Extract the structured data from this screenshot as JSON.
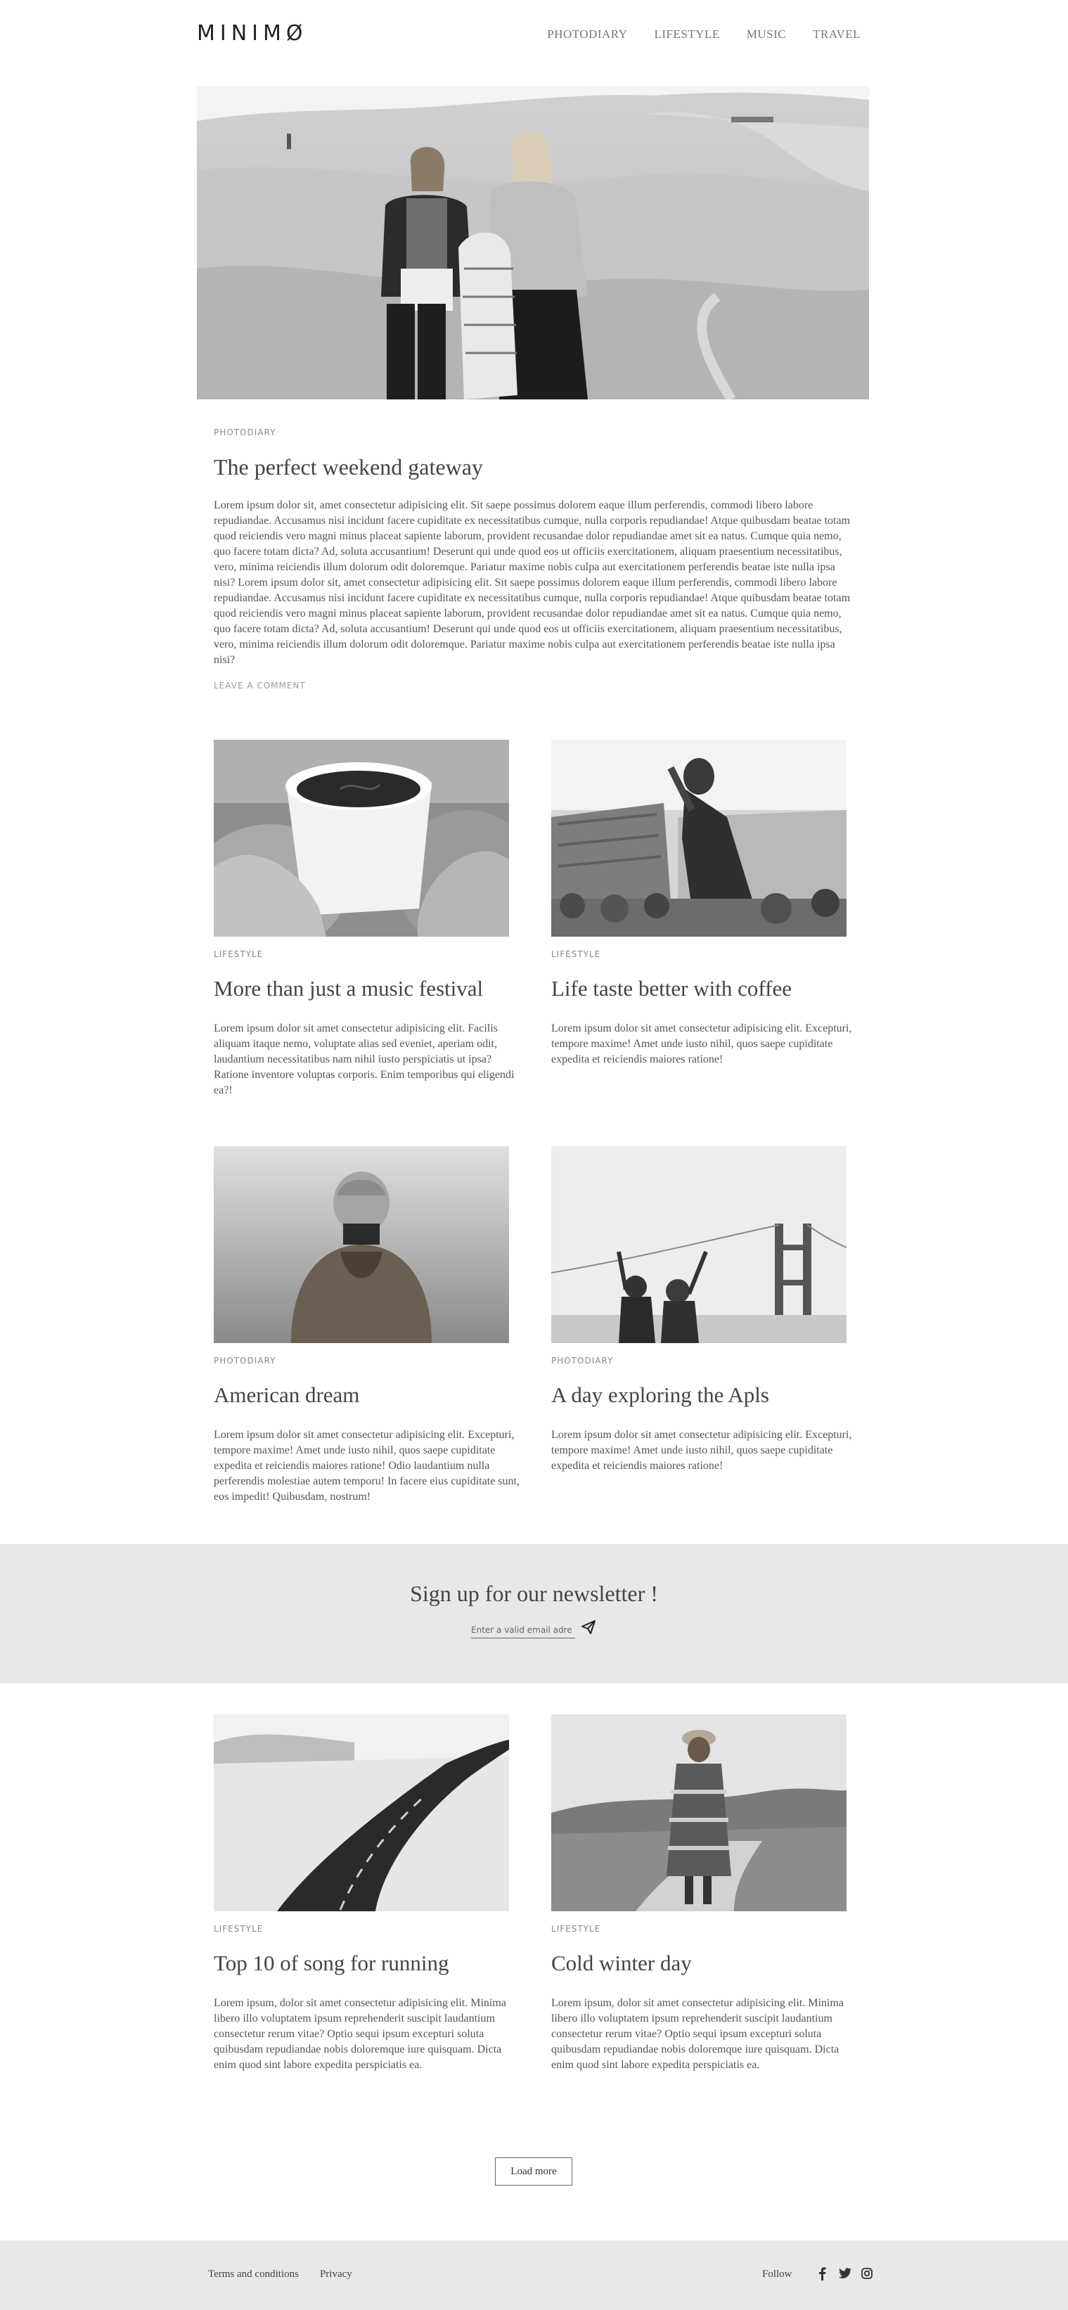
{
  "header": {
    "logo": "MINIMØ",
    "nav": [
      "PHOTODIARY",
      "LIFESTYLE",
      "MUSIC",
      "TRAVEL"
    ]
  },
  "feature": {
    "category": "PHOTODIARY",
    "title": "The perfect weekend gateway",
    "body": "Lorem ipsum dolor sit, amet consectetur adipisicing elit. Sit saepe possimus dolorem eaque illum perferendis, commodi libero labore repudiandae. Accusamus nisi incidunt facere cupiditate ex necessitatibus cumque, nulla corporis repudiandae! Atque quibusdam beatae totam quod reiciendis vero magni minus placeat sapiente laborum, provident recusandae dolor repudiandae amet sit ea natus. Cumque quia nemo, quo facere totam dicta? Ad, soluta accusantium! Deserunt qui unde quod eos ut officiis exercitationem, aliquam praesentium necessitatibus, vero, minima reiciendis illum dolorum odit doloremque. Pariatur maxime nobis culpa aut exercitationem perferendis beatae iste nulla ipsa nisi? Lorem ipsum dolor sit, amet consectetur adipisicing elit. Sit saepe possimus dolorem eaque illum perferendis, commodi libero labore repudiandae. Accusamus nisi incidunt facere cupiditate ex necessitatibus cumque, nulla corporis repudiandae! Atque quibusdam beatae totam quod reiciendis vero magni minus placeat sapiente laborum, provident recusandae dolor repudiandae amet sit ea natus. Cumque quia nemo, quo facere totam dicta? Ad, soluta accusantium! Deserunt qui unde quod eos ut officiis exercitationem, aliquam praesentium necessitatibus, vero, minima reiciendis illum dolorum odit doloremque. Pariatur maxime nobis culpa aut exercitationem perferendis beatae iste nulla ipsa nisi?",
    "comment_link": "LEAVE A COMMENT"
  },
  "posts": [
    {
      "category": "LIFESTYLE",
      "title": "More than just a music festival",
      "body": "Lorem ipsum dolor sit amet consectetur adipisicing elit. Facilis aliquam itaque nemo, voluptate alias sed eveniet, aperiam odit, laudantium necessitatibus nam nihil iusto perspiciatis ut ipsa? Ratione inventore voluptas corporis. Enim temporibus qui eligendi ea?!"
    },
    {
      "category": "LIFESTYLE",
      "title": "Life taste better with coffee",
      "body": "Lorem ipsum dolor sit amet consectetur adipisicing elit. Excepturi, tempore maxime! Amet unde iusto nihil, quos saepe cupiditate expedita et reiciendis maiores ratione!"
    },
    {
      "category": "PHOTODIARY",
      "title": "American dream",
      "body": "Lorem ipsum dolor sit amet consectetur adipisicing elit. Excepturi, tempore maxime! Amet unde iusto nihil, quos saepe cupiditate expedita et reiciendis maiores ratione! Odio laudantium nulla perferendis molestiae autem temporu! In facere eius cupiditate sunt, eos impedit! Quibusdam, nostrum!"
    },
    {
      "category": "PHOTODIARY",
      "title": "A day exploring the Apls",
      "body": "Lorem ipsum dolor sit amet consectetur adipisicing elit. Excepturi, tempore maxime! Amet unde iusto nihil, quos saepe cupiditate expedita et reiciendis maiores ratione!"
    },
    {
      "category": "LIFESTYLE",
      "title": "Top 10 of song for running",
      "body": "Lorem ipsum, dolor sit amet consectetur adipisicing elit. Minima libero illo voluptatem ipsum reprehenderit suscipit laudantium consectetur rerum vitae? Optio sequi ipsum excepturi soluta quibusdam repudiandae nobis doloremque iure quisquam. Dicta enim quod sint labore expedita perspiciatis ea."
    },
    {
      "category": "LIFESTYLE",
      "title": "Cold winter day",
      "body": "Lorem ipsum, dolor sit amet consectetur adipisicing elit. Minima libero illo voluptatem ipsum reprehenderit suscipit laudantium consectetur rerum vitae? Optio sequi ipsum excepturi soluta quibusdam repudiandae nobis doloremque iure quisquam. Dicta enim quod sint labore expedita perspiciatis ea."
    }
  ],
  "newsletter": {
    "heading": "Sign up for our newsletter !",
    "placeholder": "Enter a valid email adre",
    "send_icon": "paper-plane-icon"
  },
  "load_more": "Load more",
  "footer": {
    "links": [
      "Terms and conditions",
      "Privacy"
    ],
    "follow": "Follow",
    "social_icons": [
      "facebook-icon",
      "twitter-icon",
      "instagram-icon"
    ]
  }
}
